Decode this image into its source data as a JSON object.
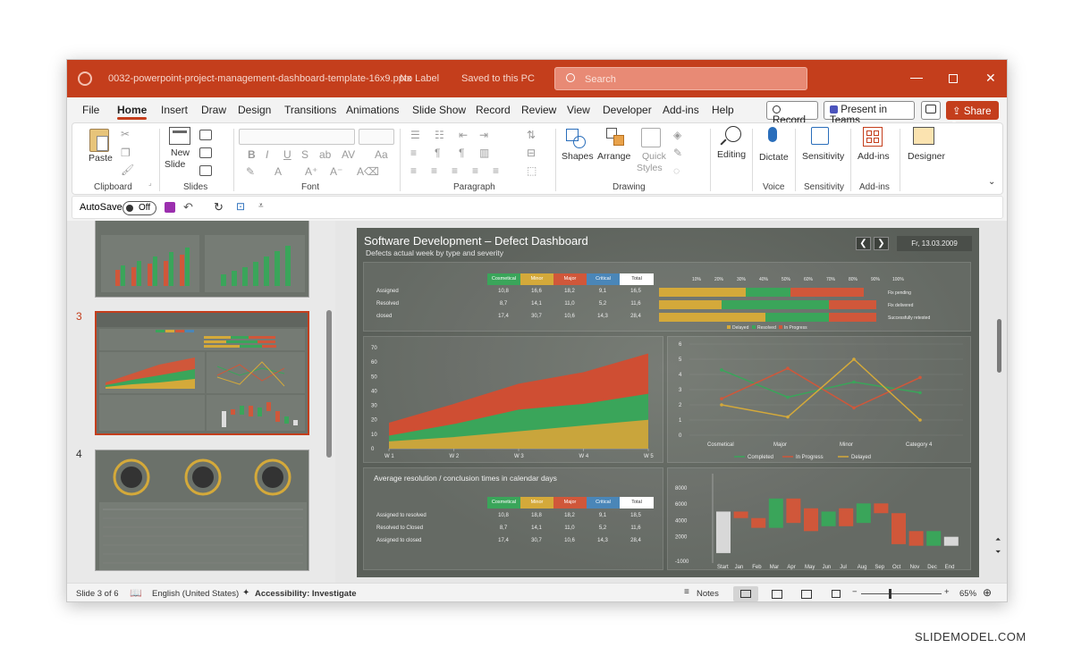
{
  "window": {
    "doc_title": "0032-powerpoint-project-management-dashboard-template-16x9.pptx",
    "label_state": "No Label",
    "saved_state": "Saved to this PC",
    "search_placeholder": "Search"
  },
  "menu": {
    "tabs": [
      "File",
      "Home",
      "Insert",
      "Draw",
      "Design",
      "Transitions",
      "Animations",
      "Slide Show",
      "Record",
      "Review",
      "View",
      "Developer",
      "Add-ins",
      "Help"
    ],
    "active": "Home",
    "record": "Record",
    "present": "Present in Teams",
    "share": "Share"
  },
  "ribbon": {
    "paste": "Paste",
    "new_slide_1": "New",
    "new_slide_2": "Slide",
    "shapes": "Shapes",
    "arrange": "Arrange",
    "quick_styles_1": "Quick",
    "quick_styles_2": "Styles",
    "editing": "Editing",
    "dictate": "Dictate",
    "sensitivity": "Sensitivity",
    "addins": "Add-ins",
    "designer": "Designer",
    "groups": {
      "clipboard": "Clipboard",
      "slides": "Slides",
      "font": "Font",
      "paragraph": "Paragraph",
      "drawing": "Drawing",
      "voice": "Voice",
      "sensitivity": "Sensitivity",
      "addins": "Add-ins"
    }
  },
  "qat": {
    "autosave": "AutoSave",
    "toggle": "Off"
  },
  "thumbs": {
    "n3": "3",
    "n4": "4"
  },
  "slide": {
    "title": "Software Development – Defect Dashboard",
    "subtitle": "Defects actual week by type and severity",
    "date": "Fr, 13.03.2009",
    "table_headers": [
      "Cosmetical",
      "Minor",
      "Major",
      "Critical",
      "Total"
    ],
    "header_colors": [
      "#3aa55a",
      "#d4a93a",
      "#d0573a",
      "#4a86b8",
      "#ffffff"
    ],
    "top_table": {
      "rows": [
        {
          "label": "Assigned",
          "values": [
            "10,8",
            "16,6",
            "18,2",
            "9,1",
            "16,5"
          ]
        },
        {
          "label": "Resolved",
          "values": [
            "8,7",
            "14,1",
            "11,0",
            "5,2",
            "11,6"
          ]
        },
        {
          "label": "closed",
          "values": [
            "17,4",
            "30,7",
            "10,6",
            "14,3",
            "28,4"
          ]
        }
      ]
    },
    "stacked_pct": {
      "ticks": [
        "10%",
        "20%",
        "30%",
        "40%",
        "50%",
        "60%",
        "70%",
        "80%",
        "90%",
        "100%"
      ],
      "row_labels": [
        "Fix pending",
        "Fix delivered",
        "Successfully retested"
      ],
      "legend": [
        "Delayed",
        "Resolved",
        "In Progress"
      ]
    },
    "area_chart": {
      "yticks": [
        "70",
        "60",
        "50",
        "40",
        "30",
        "20",
        "10",
        "0"
      ],
      "xticks": [
        "W 1",
        "W 2",
        "W 3",
        "W 4",
        "W 5"
      ]
    },
    "line_chart": {
      "yticks": [
        "6",
        "5",
        "4",
        "3",
        "2",
        "1",
        "0"
      ],
      "xticks": [
        "Cosmetical",
        "Major",
        "Minor",
        "Category 4"
      ],
      "legend": [
        "Completed",
        "In Progress",
        "Delayed"
      ]
    },
    "bottom_title": "Average resolution / conclusion times in calendar days",
    "bottom_table": {
      "rows": [
        {
          "label": "Assigned to resolved",
          "values": [
            "10,8",
            "18,8",
            "18,2",
            "9,1",
            "18,5"
          ]
        },
        {
          "label": "Resolved to Closed",
          "values": [
            "8,7",
            "14,1",
            "11,0",
            "5,2",
            "11,6"
          ]
        },
        {
          "label": "Assigned to closed",
          "values": [
            "17,4",
            "30,7",
            "10,6",
            "14,3",
            "28,4"
          ]
        }
      ]
    },
    "waterfall": {
      "yticks": [
        "8000",
        "6000",
        "4000",
        "2000",
        "-1000"
      ],
      "xticks": [
        "Start",
        "Jan",
        "Feb",
        "Mar",
        "Apr",
        "May",
        "Jun",
        "Jul",
        "Aug",
        "Sep",
        "Oct",
        "Nov",
        "Dec",
        "End"
      ]
    }
  },
  "chart_data": [
    {
      "type": "area",
      "x": [
        "W 1",
        "W 2",
        "W 3",
        "W 4",
        "W 5"
      ],
      "ylim": [
        0,
        70
      ],
      "series": [
        {
          "values": [
            5,
            8,
            12,
            16,
            20
          ]
        },
        {
          "values": [
            9,
            17,
            27,
            31,
            38
          ]
        },
        {
          "values": [
            18,
            31,
            45,
            53,
            66
          ]
        }
      ]
    },
    {
      "type": "line",
      "categories": [
        "Cosmetical",
        "Major",
        "Minor",
        "Category 4"
      ],
      "ylim": [
        0,
        6
      ],
      "series": [
        {
          "name": "Completed",
          "values": [
            4.3,
            2.5,
            3.5,
            2.8
          ]
        },
        {
          "name": "In Progress",
          "values": [
            2.4,
            4.4,
            1.8,
            3.8
          ]
        },
        {
          "name": "Delayed",
          "values": [
            2.0,
            1.2,
            5.0,
            1.0
          ]
        }
      ]
    },
    {
      "type": "bar",
      "categories": [
        "Start",
        "Jan",
        "Feb",
        "Mar",
        "Apr",
        "May",
        "Jun",
        "Jul",
        "Aug",
        "Sep",
        "Oct",
        "Nov",
        "Dec",
        "End"
      ],
      "ylim": [
        -1000,
        8000
      ],
      "ranges": [
        [
          0,
          5100
        ],
        [
          4300,
          5100
        ],
        [
          3100,
          4300
        ],
        [
          3100,
          6700
        ],
        [
          3700,
          6700
        ],
        [
          2700,
          5500
        ],
        [
          3300,
          5100
        ],
        [
          3300,
          5500
        ],
        [
          3700,
          6100
        ],
        [
          4900,
          6100
        ],
        [
          1100,
          4900
        ],
        [
          900,
          2700
        ],
        [
          900,
          2700
        ],
        [
          900,
          2000
        ]
      ],
      "colors": [
        "#d8d8d8",
        "#d0573a",
        "#d0573a",
        "#3aa55a",
        "#d0573a",
        "#d0573a",
        "#3aa55a",
        "#d0573a",
        "#3aa55a",
        "#d0573a",
        "#d0573a",
        "#d0573a",
        "#3aa55a",
        "#d8d8d8"
      ]
    }
  ],
  "status": {
    "slide": "Slide 3 of 6",
    "language": "English (United States)",
    "accessibility": "Accessibility: Investigate",
    "notes": "Notes",
    "zoom": "65%"
  },
  "watermark": "SLIDEMODEL.COM"
}
